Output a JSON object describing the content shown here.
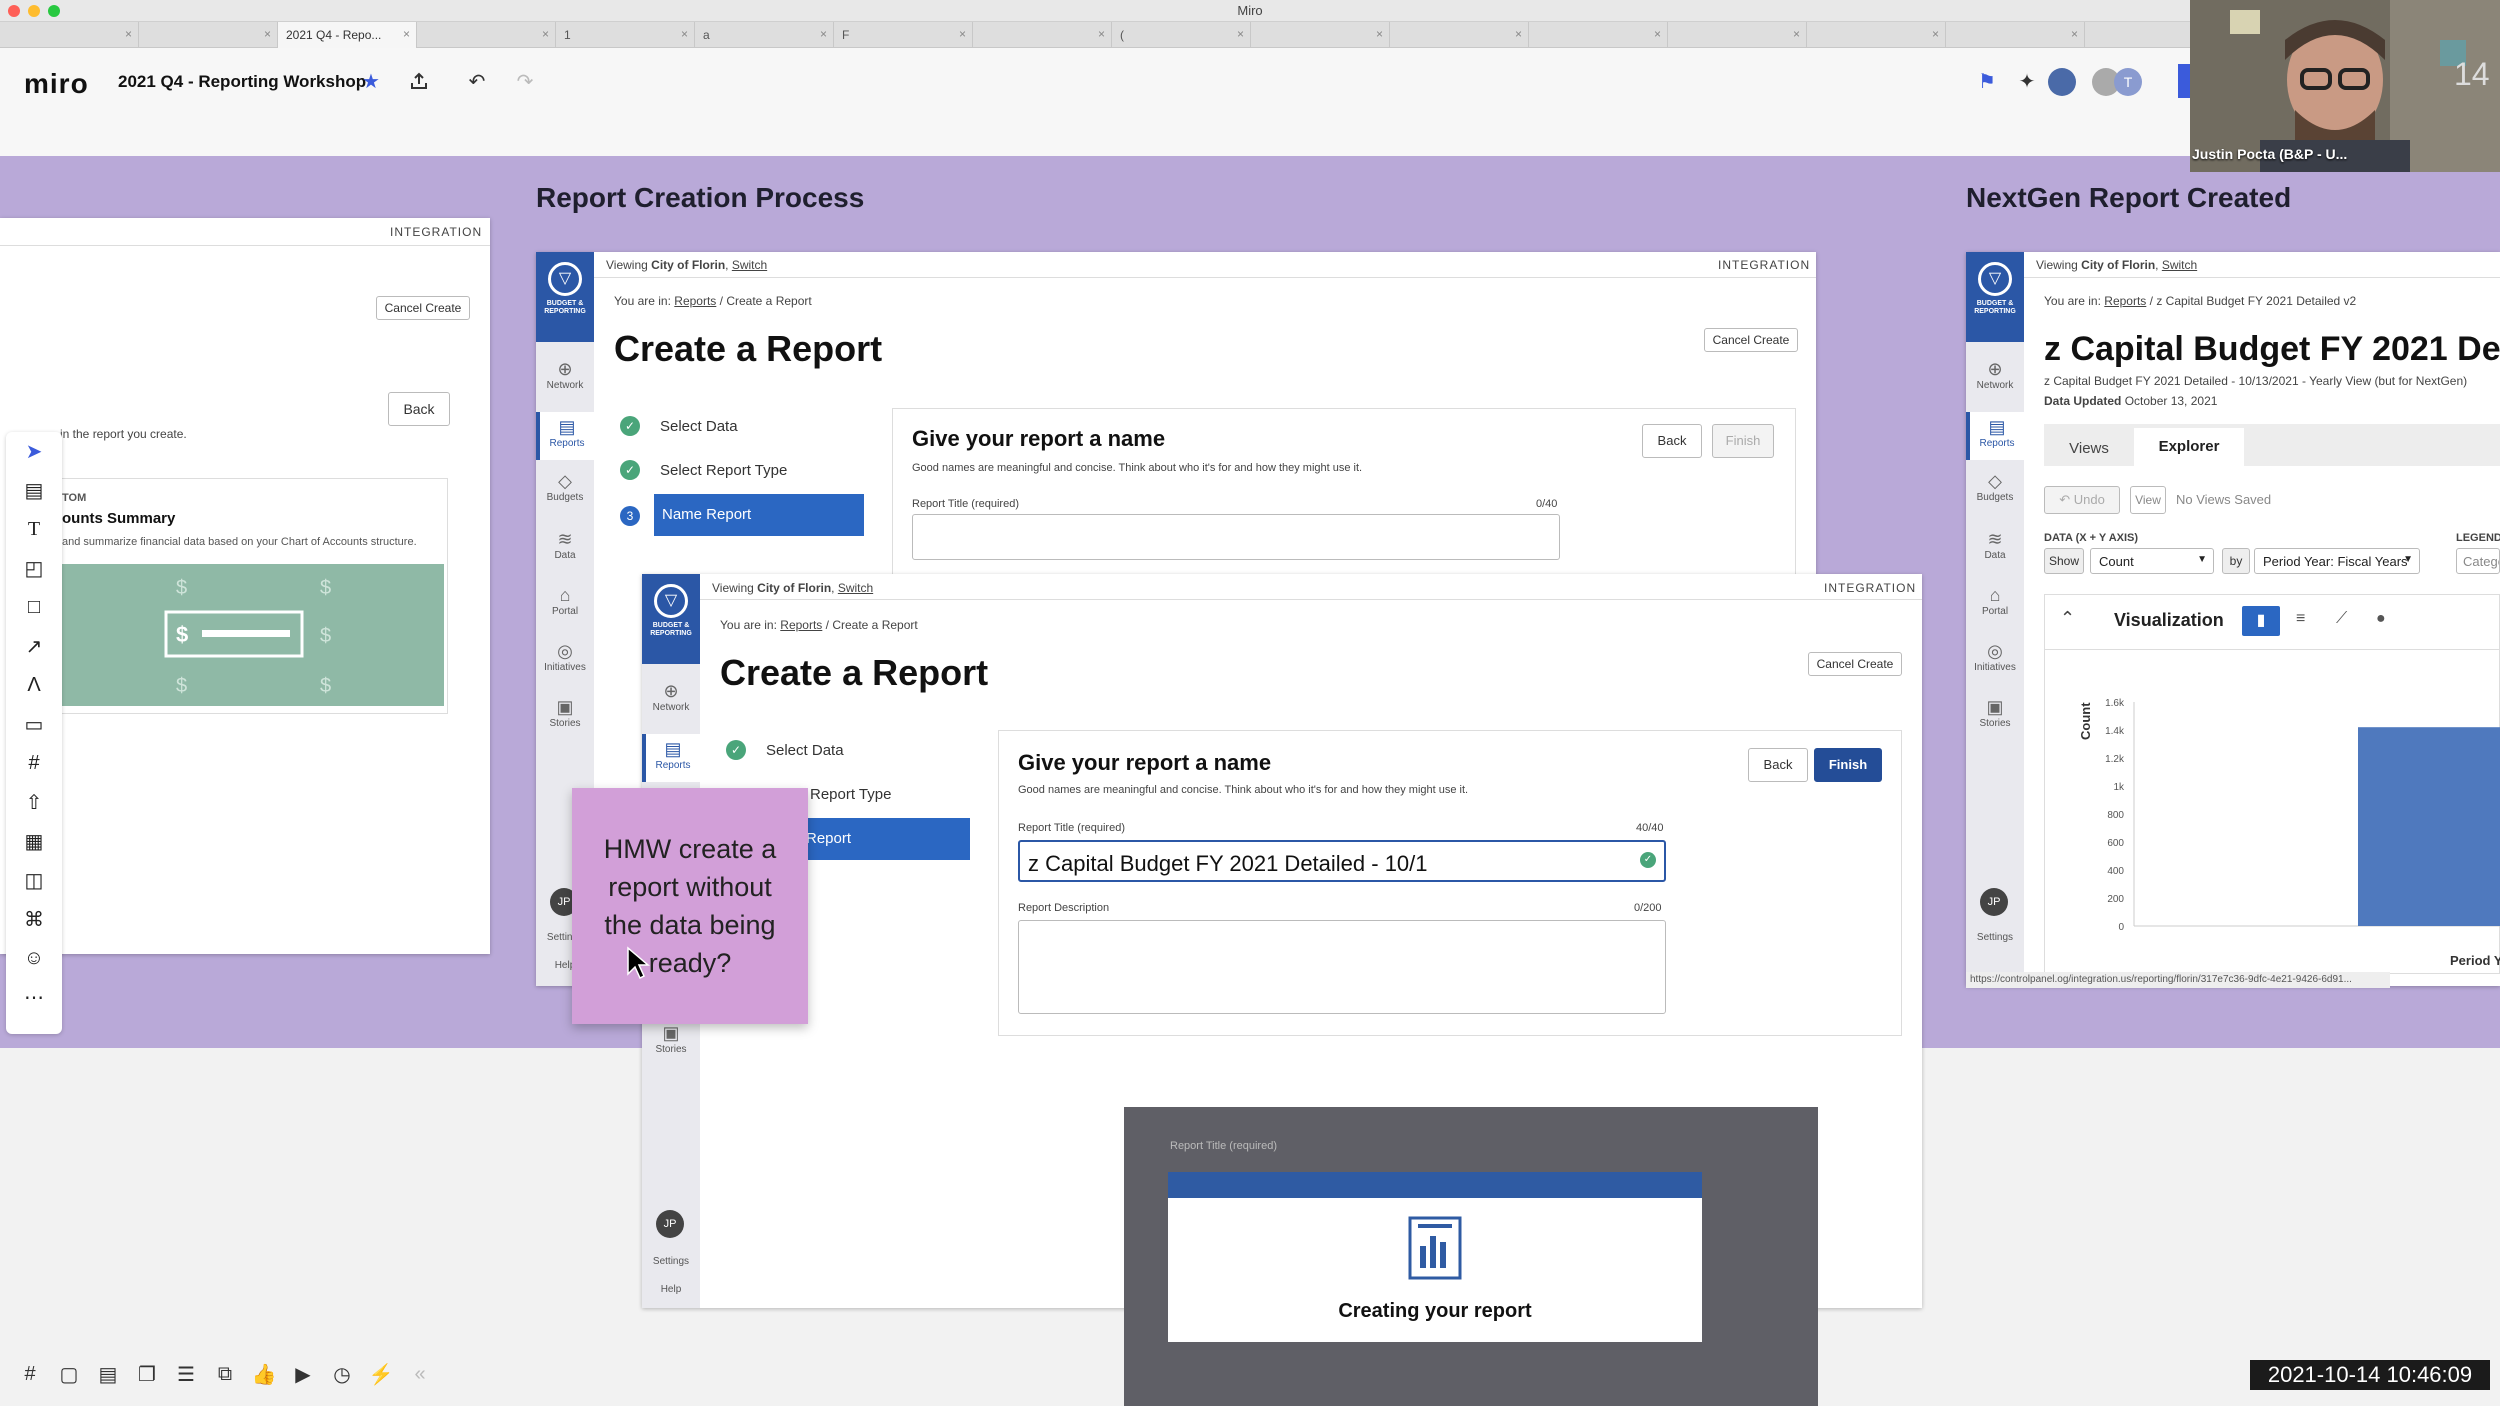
{
  "window": {
    "title": "Miro"
  },
  "tabs": [
    {
      "label": "",
      "active": false
    },
    {
      "label": "",
      "active": false
    },
    {
      "label": "2021 Q4 - Repo...",
      "active": true
    },
    {
      "label": "",
      "active": false
    },
    {
      "label": "1",
      "active": false
    },
    {
      "label": "a",
      "active": false
    },
    {
      "label": "F",
      "active": false
    },
    {
      "label": "",
      "active": false
    },
    {
      "label": "(",
      "active": false
    },
    {
      "label": "",
      "active": false
    },
    {
      "label": "",
      "active": false
    },
    {
      "label": "",
      "active": false
    },
    {
      "label": "",
      "active": false
    },
    {
      "label": "",
      "active": false
    },
    {
      "label": "",
      "active": false
    }
  ],
  "miro": {
    "logo": "miro",
    "board_name": "2021 Q4 - Reporting Workshop",
    "avatar_initial": "T"
  },
  "frames": {
    "report_creation": "Report Creation Process",
    "nextgen": "NextGen Report Created"
  },
  "app": {
    "nav_logo_text": "BUDGET & REPORTING",
    "nav_items": [
      "Network",
      "Reports",
      "Budgets",
      "Data",
      "Portal",
      "Initiatives",
      "Stories"
    ],
    "nav_bottom": {
      "avatar": "JP",
      "settings": "Settings",
      "help": "Help"
    },
    "viewing_prefix": "Viewing",
    "viewing_city": "City of Florin",
    "switch": "Switch",
    "integration": "INTEGRATION",
    "you_are_in": "You are in:",
    "crumb_reports": "Reports",
    "crumb_create": "Create a Report",
    "page_title": "Create a Report",
    "cancel_create": "Cancel Create",
    "steps": [
      "Select Data",
      "Select Report Type",
      "Name Report"
    ],
    "step3_num": "3",
    "give_name": "Give your report a name",
    "give_name_desc": "Good names are meaningful and concise. Think about who it's for and how they might use it.",
    "back": "Back",
    "finish": "Finish",
    "title_label": "Report Title (required)",
    "count_empty": "0/40",
    "count_full": "40/40",
    "title_value": "z Capital Budget FY 2021 Detailed - 10/1",
    "desc_label": "Report Description",
    "desc_count": "0/200",
    "step2_partial": "Report Type",
    "step3_partial": "Report",
    "creating": "Creating your report"
  },
  "left_screen": {
    "integration": "INTEGRATION",
    "cancel_create": "Cancel Create",
    "back": "Back",
    "hint": "in the report you create.",
    "custom_label": "TOM",
    "summary_title": "ounts Summary",
    "summary_desc": "and summarize financial data based on your Chart of Accounts structure."
  },
  "nextgen": {
    "crumb_title": "z Capital Budget FY 2021 Detailed v2",
    "title": "z Capital Budget FY 2021 De",
    "subtitle": "z Capital Budget FY 2021 Detailed - 10/13/2021 - Yearly View (but for NextGen)",
    "data_updated_label": "Data Updated",
    "data_updated": "October 13, 2021",
    "tabs": [
      "Views",
      "Explorer"
    ],
    "undo": "Undo",
    "view": "View",
    "no_views": "No Views Saved",
    "data_axis": "DATA (X + Y AXIS)",
    "legend": "LEGEND",
    "show": "Show",
    "count_select": "Count",
    "by": "by",
    "period_select": "Period Year: Fiscal Years",
    "catego": "Catego",
    "visualization": "Visualization",
    "y_axis_label": "Count",
    "x_axis_partial": "Period Y",
    "url": "https://controlpanel.og/integration.us/reporting/florin/317e7c36-9dfc-4e21-9426-6d91..."
  },
  "chart_data": {
    "type": "bar",
    "ylabel": "Count",
    "xlabel": "Period Y",
    "yticks": [
      "1.6k",
      "1.4k",
      "1.2k",
      "1k",
      "800",
      "600",
      "400",
      "200",
      "0"
    ],
    "ylim": [
      0,
      1600
    ],
    "values": [
      1420
    ]
  },
  "sticky": {
    "text": "HMW create a report without the data being ready?"
  },
  "video": {
    "name": "Justin Pocta (B&P - U...",
    "corner": "14"
  },
  "timestamp": "2021-10-14  10:46:09"
}
